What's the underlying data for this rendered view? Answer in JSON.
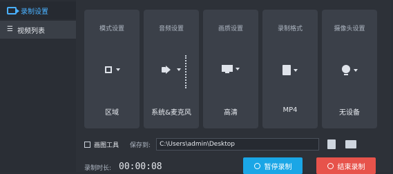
{
  "sidebar": {
    "items": [
      {
        "label": "录制设置",
        "icon": "record-icon",
        "active": true
      },
      {
        "label": "视频列表",
        "icon": "list-icon",
        "active": false
      }
    ]
  },
  "cards": [
    {
      "title": "模式设置",
      "value": "区域",
      "icon": "region-select-icon"
    },
    {
      "title": "音频设置",
      "value": "系统&麦克风",
      "icon": "speaker-icon"
    },
    {
      "title": "画质设置",
      "value": "高清",
      "icon": "monitor-icon"
    },
    {
      "title": "录制格式",
      "value": "MP4",
      "icon": "file-icon"
    },
    {
      "title": "摄像头设置",
      "value": "无设备",
      "icon": "webcam-icon"
    }
  ],
  "bottom": {
    "drawing_tool_label": "画图工具",
    "save_to_label": "保存到:",
    "save_path": "C:\\Users\\admin\\Desktop"
  },
  "timer": {
    "label": "录制时长:",
    "value": "00:00:08"
  },
  "actions": {
    "pause_label": "暂停录制",
    "stop_label": "结束录制"
  },
  "colors": {
    "accent": "#4ab1ff",
    "pause": "#1aa6e6",
    "stop": "#e7534b"
  }
}
